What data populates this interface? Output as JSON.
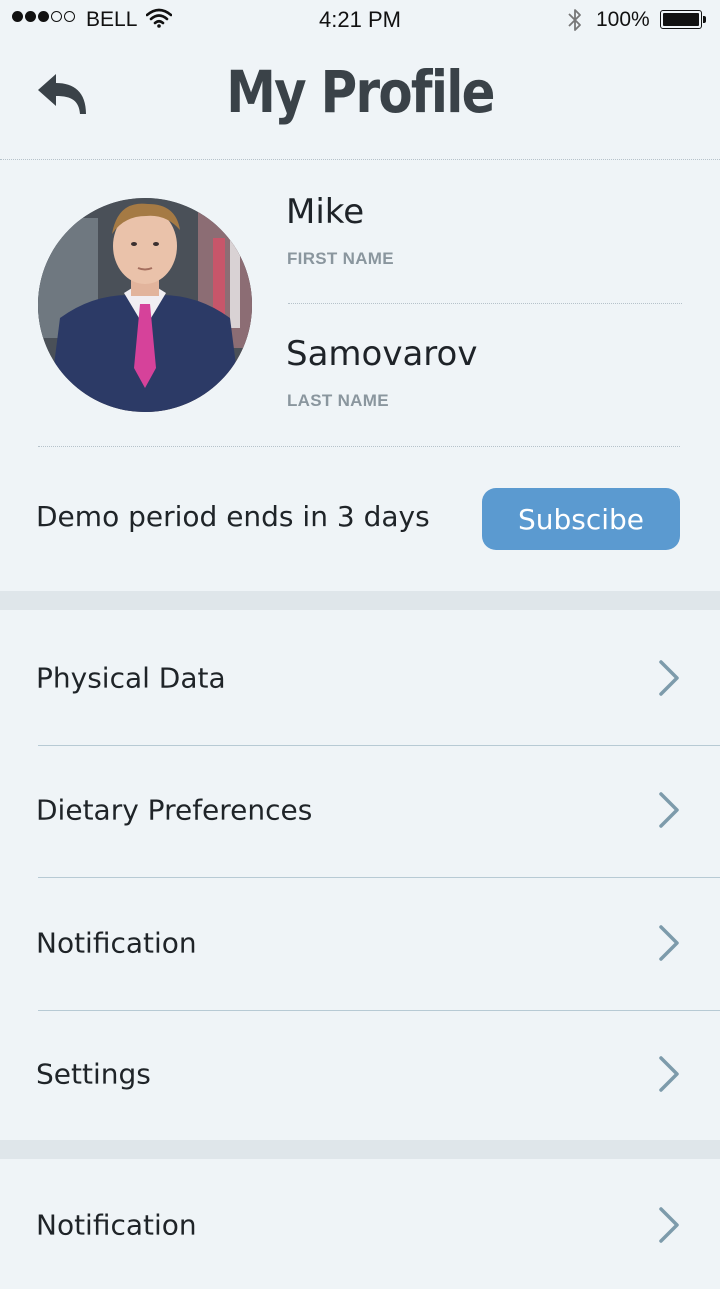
{
  "status_bar": {
    "carrier": "BELL",
    "time": "4:21 PM",
    "battery": "100%",
    "signal_bars_filled": 3,
    "signal_bars_total": 5,
    "battery_level": 1.0
  },
  "header": {
    "title": "My Profile",
    "back_icon": "back-arrow-icon"
  },
  "profile": {
    "first_name": "Mike",
    "first_name_label": "FIRST NAME",
    "last_name": "Samovarov",
    "last_name_label": "LAST NAME"
  },
  "subscription": {
    "message": "Demo period ends in 3 days",
    "button_label": "Subscibe",
    "button_color": "#5b9ad0"
  },
  "menu": {
    "items": [
      {
        "label": "Physical Data"
      },
      {
        "label": "Dietary Preferences"
      },
      {
        "label": "Notification"
      },
      {
        "label": "Settings"
      }
    ],
    "second_section": [
      {
        "label": "Notification"
      }
    ]
  },
  "colors": {
    "background": "#eff4f7",
    "separator": "#dfe6ea",
    "chevron": "#7d9bab",
    "title": "#3a4248"
  }
}
